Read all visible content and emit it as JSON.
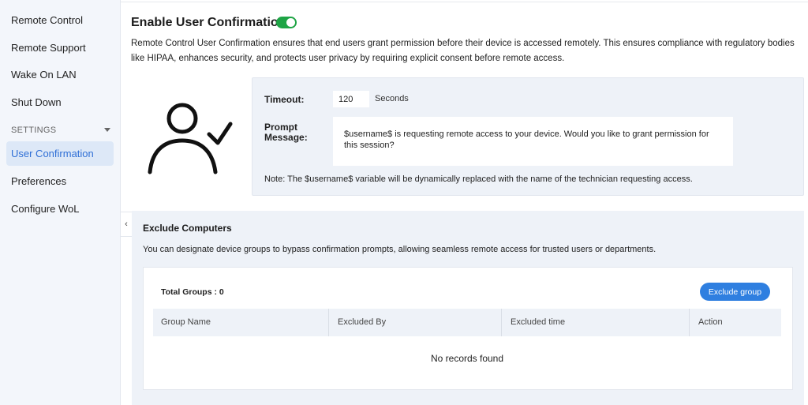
{
  "sidebar": {
    "items": [
      {
        "label": "Remote Control"
      },
      {
        "label": "Remote Support"
      },
      {
        "label": "Wake On LAN"
      },
      {
        "label": "Shut Down"
      }
    ],
    "section": "SETTINGS",
    "settings_items": [
      {
        "label": "User Confirmation",
        "active": true
      },
      {
        "label": "Preferences"
      },
      {
        "label": "Configure WoL"
      }
    ],
    "collapse_glyph": "‹"
  },
  "header": {
    "title": "Enable User Confirmation",
    "toggle_on": true,
    "description": "Remote Control User Confirmation ensures that end users grant permission before their device is accessed remotely. This ensures compliance with regulatory bodies like HIPAA, enhances security, and protects user privacy by requiring explicit consent before remote access."
  },
  "confirmation": {
    "icon": "user-check-icon",
    "timeout_label": "Timeout:",
    "timeout_value": "120",
    "timeout_unit": "Seconds",
    "prompt_label_line1": "Prompt",
    "prompt_label_line2": "Message:",
    "prompt_message": "$username$ is requesting remote access to your device. Would you like to grant permission for this session?",
    "note": "Note: The $username$ variable will be dynamically replaced with the name of the technician requesting access."
  },
  "exclude": {
    "title": "Exclude Computers",
    "description": "You can designate device groups to bypass confirmation prompts, allowing seamless remote access for trusted users or departments.",
    "total_label": "Total Groups : 0",
    "button_label": "Exclude group",
    "columns": [
      "Group Name",
      "Excluded By",
      "Excluded time",
      "Action"
    ],
    "empty_text": "No records found"
  },
  "colors": {
    "accent": "#2f7fe0",
    "toggle": "#1ea445",
    "active_item": "#2f6fd6"
  }
}
